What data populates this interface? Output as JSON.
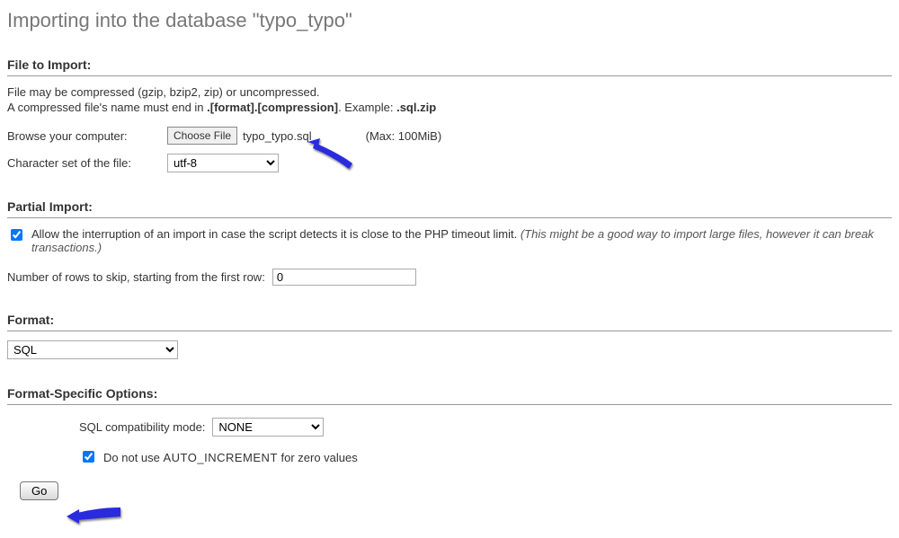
{
  "title": "Importing into the database \"typo_typo\"",
  "file_section": {
    "heading": "File to Import:",
    "desc_line1": "File may be compressed (gzip, bzip2, zip) or uncompressed.",
    "desc_line2_pre": "A compressed file's name must end in ",
    "desc_line2_bold": ".[format].[compression]",
    "desc_line2_post": ". Example: ",
    "desc_line2_example": ".sql.zip",
    "browse_label": "Browse your computer:",
    "choose_button": "Choose File",
    "chosen_file": "typo_typo.sql",
    "max_label": "(Max: 100MiB)",
    "charset_label": "Character set of the file:",
    "charset_value": "utf-8"
  },
  "partial_section": {
    "heading": "Partial Import:",
    "allow_interrupt_checked": true,
    "allow_interrupt_label": "Allow the interruption of an import in case the script detects it is close to the PHP timeout limit. ",
    "allow_interrupt_note": "(This might be a good way to import large files, however it can break transactions.)",
    "skip_rows_label": "Number of rows to skip, starting from the first row:",
    "skip_rows_value": "0"
  },
  "format_section": {
    "heading": "Format:",
    "format_value": "SQL"
  },
  "fso_section": {
    "heading": "Format-Specific Options:",
    "compat_label": "SQL compatibility mode:",
    "compat_value": "NONE",
    "no_ai_checked": true,
    "no_ai_pre": "Do not use ",
    "no_ai_code": "AUTO_INCREMENT",
    "no_ai_post": " for zero values"
  },
  "go_label": "Go"
}
